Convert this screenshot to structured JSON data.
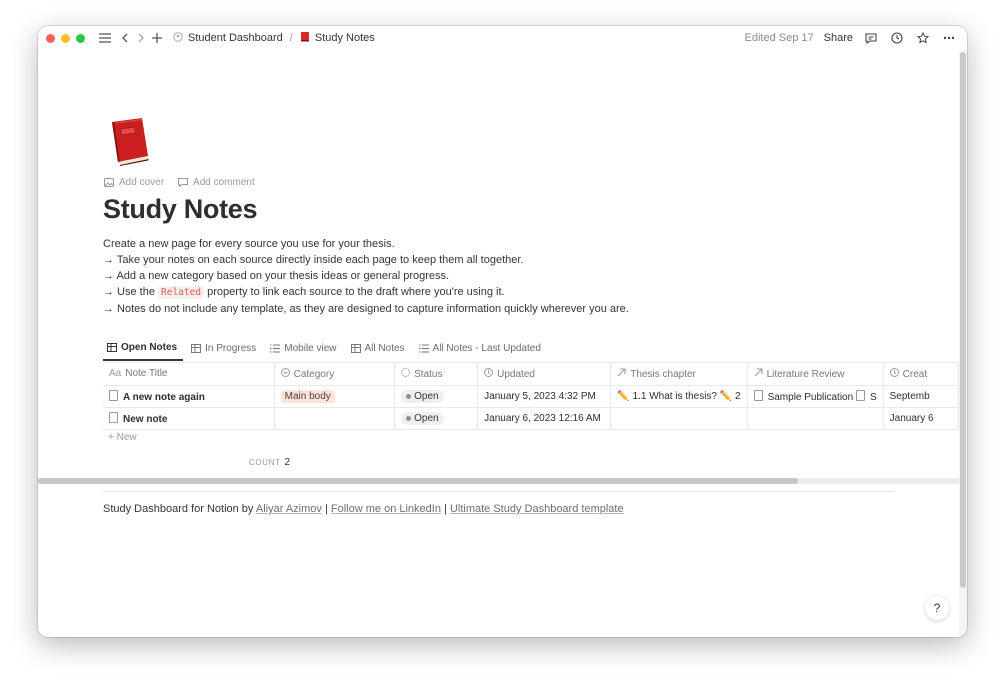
{
  "breadcrumb": {
    "parent": "Student Dashboard",
    "current": "Study Notes"
  },
  "toolbar": {
    "edited": "Edited Sep 17",
    "share": "Share"
  },
  "page": {
    "add_cover": "Add cover",
    "add_comment": "Add comment",
    "title": "Study Notes",
    "desc_line1": "Create a new page for every source you use for your thesis.",
    "desc_line2": "→ Take your notes on each source directly inside each page to keep them all together.",
    "desc_line3": "→ Add a new category based on your thesis ideas or general progress.",
    "desc_line4_pre": "→ Use the",
    "desc_line4_code": "Related",
    "desc_line4_post": "property to link each source to the draft where you're using it.",
    "desc_line5": "→ Notes do not include any template, as they are designed to capture information quickly wherever you are."
  },
  "tabs": [
    {
      "label": "Open Notes",
      "icon": "table-icon"
    },
    {
      "label": "In Progress",
      "icon": "table-icon"
    },
    {
      "label": "Mobile view",
      "icon": "list-icon"
    },
    {
      "label": "All Notes",
      "icon": "table-icon"
    },
    {
      "label": "All Notes - Last Updated",
      "icon": "list-icon"
    }
  ],
  "table": {
    "columns": [
      {
        "label": "Note Title",
        "icon": "Aa"
      },
      {
        "label": "Category",
        "icon": "select-icon"
      },
      {
        "label": "Status",
        "icon": "status-icon"
      },
      {
        "label": "Updated",
        "icon": "clock-icon"
      },
      {
        "label": "Thesis chapter",
        "icon": "relation-icon"
      },
      {
        "label": "Literature Review",
        "icon": "relation-icon"
      },
      {
        "label": "Creat",
        "icon": "clock-icon"
      }
    ],
    "rows": [
      {
        "title": "A new note again",
        "category": "Main body",
        "status": "Open",
        "updated": "January 5, 2023 4:32 PM",
        "thesis": "1.1 What is thesis?",
        "thesis_extra": "2",
        "literature": "Sample Publication",
        "literature_extra": "S",
        "created": "Septemb"
      },
      {
        "title": "New note",
        "category": "",
        "status": "Open",
        "updated": "January 6, 2023 12:16 AM",
        "thesis": "",
        "thesis_extra": "",
        "literature": "",
        "literature_extra": "",
        "created": "January 6"
      }
    ],
    "new_label": "New",
    "count_label": "COUNT",
    "count_value": "2"
  },
  "footer": {
    "prefix": "Study Dashboard for Notion by",
    "author": "Aliyar Azimov",
    "sep": "|",
    "linkedin": "Follow me on LinkedIn",
    "template": "Ultimate Study Dashboard template"
  },
  "help": "?"
}
